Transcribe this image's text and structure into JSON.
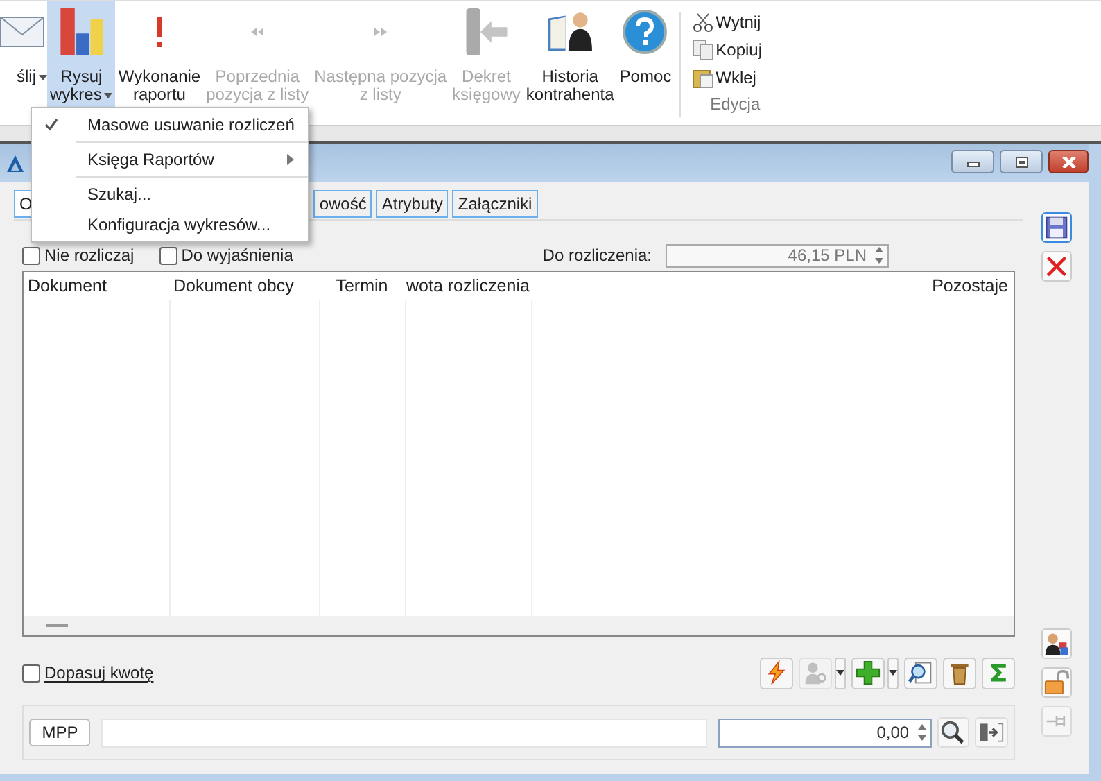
{
  "ribbon": {
    "buttons": [
      {
        "lines": [
          "ślij"
        ],
        "disabled": false,
        "selected": false,
        "dropdown": true
      },
      {
        "lines": [
          "Rysuj",
          "wykres"
        ],
        "disabled": false,
        "selected": true,
        "dropdown": true
      },
      {
        "lines": [
          "Wykonanie",
          "raportu"
        ],
        "disabled": false,
        "selected": false,
        "dropdown": false
      },
      {
        "lines": [
          "Poprzednia",
          "pozycja z listy"
        ],
        "disabled": true,
        "selected": false,
        "dropdown": false
      },
      {
        "lines": [
          "Następna pozycja",
          "z listy"
        ],
        "disabled": true,
        "selected": false,
        "dropdown": false
      },
      {
        "lines": [
          "Dekret",
          "księgowy"
        ],
        "disabled": true,
        "selected": false,
        "dropdown": false
      },
      {
        "lines": [
          "Historia",
          "kontrahenta"
        ],
        "disabled": false,
        "selected": false,
        "dropdown": false
      },
      {
        "lines": [
          "Pomoc"
        ],
        "disabled": false,
        "selected": false,
        "dropdown": false
      }
    ],
    "edit_group": {
      "items": [
        "Wytnij",
        "Kopiuj",
        "Wklej"
      ],
      "label": "Edycja"
    }
  },
  "menu": {
    "items": [
      {
        "kind": "item",
        "label": "Masowe usuwanie rozliczeń",
        "checked": true
      },
      {
        "kind": "submenu",
        "label": "Księga Raportów",
        "checked": false
      },
      {
        "kind": "item",
        "label": "Szukaj...",
        "checked": false
      },
      {
        "kind": "item",
        "label": "Konfiguracja wykresów...",
        "checked": false
      }
    ]
  },
  "window": {
    "tabs": [
      {
        "label": "O",
        "selected": true
      },
      {
        "label": "owość",
        "selected": false
      },
      {
        "label": "Atrybuty",
        "selected": false
      },
      {
        "label": "Załączniki",
        "selected": false
      }
    ],
    "checkboxes": [
      {
        "label": "Nie rozliczaj",
        "checked": false
      },
      {
        "label": "Do wyjaśnienia",
        "checked": false
      }
    ],
    "due": {
      "label": "Do rozliczenia:",
      "value": "46,15 PLN"
    },
    "table": {
      "columns": [
        "Dokument",
        "Dokument obcy",
        "Termin",
        "wota rozliczenia",
        "Pozostaje"
      ]
    },
    "fit_amount": {
      "label": "Dopasuj kwotę",
      "checked": false
    },
    "toolbar": [
      {
        "disabled": false,
        "dropdown": false
      },
      {
        "disabled": true,
        "dropdown": true
      },
      {
        "disabled": false,
        "dropdown": true
      },
      {
        "disabled": false,
        "dropdown": false
      },
      {
        "disabled": false,
        "dropdown": false
      },
      {
        "disabled": false,
        "dropdown": false
      }
    ],
    "mpp_button": "MPP",
    "amount": "0,00"
  }
}
